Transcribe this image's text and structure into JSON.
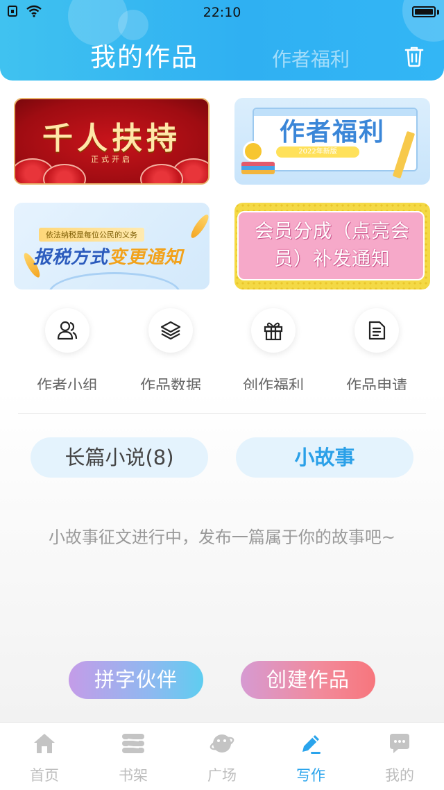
{
  "status_bar": {
    "time": "22:10",
    "left_icons": [
      "sim-icon",
      "wifi-icon"
    ],
    "battery_level": 1.0
  },
  "header": {
    "active_tab": "我的作品",
    "inactive_tab": "作者福利",
    "trash_icon": "trash-icon",
    "color": "#38b8f2"
  },
  "banners": {
    "b1": {
      "title": "千人扶持",
      "subtitle": "正式开启"
    },
    "b2": {
      "title": "作者福利",
      "badge": "2022年新版"
    },
    "b3": {
      "tag": "依法纳税是每位公民的义务",
      "title_part1": "报税方式",
      "title_part2": "变更通知"
    },
    "b4": {
      "line1": "会员分成（点亮会",
      "line2": "员）补发通知"
    }
  },
  "features": [
    {
      "label": "作者小组",
      "icon": "group-icon"
    },
    {
      "label": "作品数据",
      "icon": "layers-icon"
    },
    {
      "label": "创作福利",
      "icon": "gift-icon"
    },
    {
      "label": "作品申请",
      "icon": "document-icon"
    }
  ],
  "segments": {
    "long_novel": "长篇小说(8)",
    "short_story": "小故事"
  },
  "empty_message": "小故事征文进行中，发布一篇属于你的故事吧~",
  "actions": {
    "partner": "拼字伙伴",
    "create": "创建作品"
  },
  "nav": [
    {
      "label": "首页",
      "icon": "home-icon",
      "active": false
    },
    {
      "label": "书架",
      "icon": "bookshelf-icon",
      "active": false
    },
    {
      "label": "广场",
      "icon": "planet-icon",
      "active": false
    },
    {
      "label": "写作",
      "icon": "pen-icon",
      "active": true
    },
    {
      "label": "我的",
      "icon": "chat-icon",
      "active": false
    }
  ],
  "colors": {
    "accent": "#2aa4ec",
    "nav_inactive": "#bdbdbd",
    "segment_bg": "#e4f3fd"
  }
}
